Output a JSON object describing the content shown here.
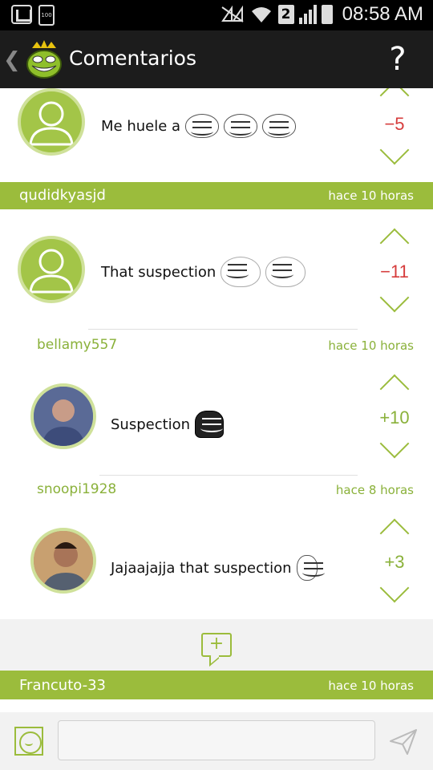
{
  "status_bar": {
    "time": "08:58 AM",
    "sim_number": "2",
    "battery_label": "100"
  },
  "app_bar": {
    "title": "Comentarios",
    "help": "?"
  },
  "comments": [
    {
      "text": "Me huele a",
      "score": "−5",
      "author": "qudidkyasjd",
      "time": "hace 10 horas"
    },
    {
      "text": "That suspection",
      "score": "−11"
    }
  ],
  "replies": [
    {
      "author": "bellamy557",
      "time": "hace 10 horas",
      "text": "Suspection",
      "score": "+10"
    },
    {
      "author": "snoopi1928",
      "time": "hace 8 horas",
      "text": "Jajaajajja that suspection",
      "score": "+3"
    }
  ],
  "bottom_author": {
    "author": "Francuto-33",
    "time": "hace 10 horas"
  },
  "input": {
    "placeholder": ""
  },
  "colors": {
    "accent": "#9bbc3c",
    "negative": "#d63c3c",
    "positive": "#8ab13a"
  }
}
